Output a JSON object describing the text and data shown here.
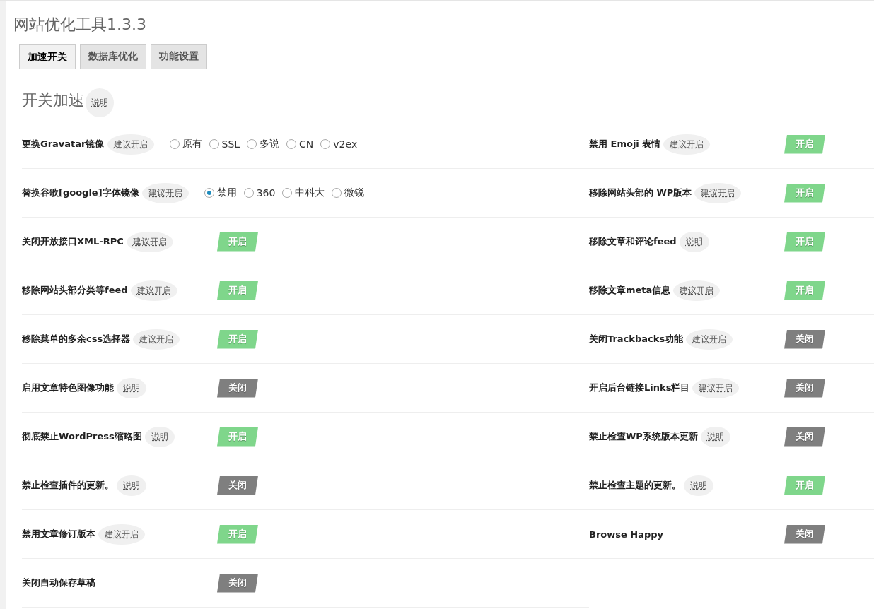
{
  "page": {
    "title": "网站优化工具1.3.3"
  },
  "tabs": [
    {
      "label": "加速开关",
      "selected": true
    },
    {
      "label": "数据库优化",
      "selected": false
    },
    {
      "label": "功能设置",
      "selected": false
    }
  ],
  "section": {
    "title": "开关加速",
    "hint": "说明"
  },
  "left_settings": [
    {
      "kind": "radio",
      "label": "更换Gravatar镜像",
      "hint": "建议开启",
      "options": [
        {
          "label": "原有",
          "selected": false
        },
        {
          "label": "SSL",
          "selected": false
        },
        {
          "label": "多说",
          "selected": false
        },
        {
          "label": "CN",
          "selected": false
        },
        {
          "label": "v2ex",
          "selected": false
        }
      ]
    },
    {
      "kind": "radio",
      "label": "替换谷歌[google]字体镜像",
      "hint": "建议开启",
      "options": [
        {
          "label": "禁用",
          "selected": true
        },
        {
          "label": "360",
          "selected": false
        },
        {
          "label": "中科大",
          "selected": false
        },
        {
          "label": "微锐",
          "selected": false
        }
      ]
    },
    {
      "kind": "toggle",
      "label": "关闭开放接口XML-RPC",
      "hint": "建议开启",
      "on": true,
      "state_text": "开启"
    },
    {
      "kind": "toggle",
      "label": "移除网站头部分类等feed",
      "hint": "建议开启",
      "on": true,
      "state_text": "开启"
    },
    {
      "kind": "toggle",
      "label": "移除菜单的多余css选择器",
      "hint": "建议开启",
      "on": true,
      "state_text": "开启"
    },
    {
      "kind": "toggle",
      "label": "启用文章特色图像功能",
      "hint": "说明",
      "on": false,
      "state_text": "关闭"
    },
    {
      "kind": "toggle",
      "label": "彻底禁止WordPress缩略图",
      "hint": "说明",
      "on": true,
      "state_text": "开启"
    },
    {
      "kind": "toggle",
      "label": "禁止检查插件的更新。",
      "hint": "说明",
      "on": false,
      "state_text": "关闭"
    },
    {
      "kind": "toggle",
      "label": "禁用文章修订版本",
      "hint": "建议开启",
      "on": true,
      "state_text": "开启"
    },
    {
      "kind": "toggle",
      "label": "关闭自动保存草稿",
      "on": false,
      "state_text": "关闭"
    }
  ],
  "right_settings": [
    {
      "kind": "toggle",
      "label": "禁用 Emoji 表情",
      "hint": "建议开启",
      "on": true,
      "state_text": "开启"
    },
    {
      "kind": "toggle",
      "label": "移除网站头部的 WP版本",
      "hint": "建议开启",
      "on": true,
      "state_text": "开启"
    },
    {
      "kind": "toggle",
      "label": "移除文章和评论feed",
      "hint": "说明",
      "on": true,
      "state_text": "开启"
    },
    {
      "kind": "toggle",
      "label": "移除文章meta信息",
      "hint": "建议开启",
      "on": true,
      "state_text": "开启"
    },
    {
      "kind": "toggle",
      "label": "关闭Trackbacks功能",
      "hint": "建议开启",
      "on": false,
      "state_text": "关闭"
    },
    {
      "kind": "toggle",
      "label": "开启后台链接Links栏目",
      "hint": "建议开启",
      "on": false,
      "state_text": "关闭"
    },
    {
      "kind": "toggle",
      "label": "禁止检查WP系统版本更新",
      "hint": "说明",
      "on": false,
      "state_text": "关闭"
    },
    {
      "kind": "toggle",
      "label": "禁止检查主题的更新。",
      "hint": "说明",
      "on": true,
      "state_text": "开启"
    },
    {
      "kind": "toggle",
      "label": "Browse Happy",
      "on": false,
      "state_text": "关闭"
    }
  ]
}
